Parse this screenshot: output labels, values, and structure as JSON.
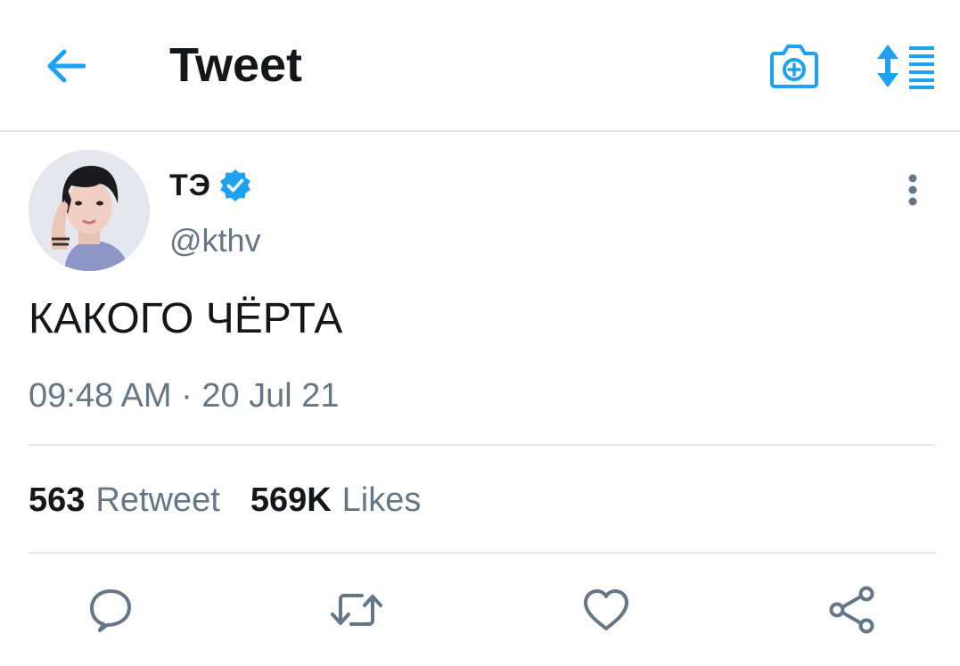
{
  "header": {
    "title": "Tweet",
    "back_icon": "arrow-left-icon",
    "camera_icon": "camera-plus-icon",
    "sort_icon": "sort-list-icon"
  },
  "tweet": {
    "display_name": "ТЭ",
    "verified": true,
    "handle": "@kthv",
    "text": "КАКОГО ЧЁРТА",
    "timestamp": "09:48 AM · 20 Jul 21",
    "retweet_count": "563",
    "retweet_label": "Retweet",
    "likes_count": "569K",
    "likes_label": "Likes"
  },
  "actions": [
    "reply-icon",
    "retweet-icon",
    "like-icon",
    "share-icon"
  ],
  "colors": {
    "accent": "#1da1f2",
    "text": "#14171a",
    "secondary": "#657786",
    "divider": "#e1e8ed"
  }
}
